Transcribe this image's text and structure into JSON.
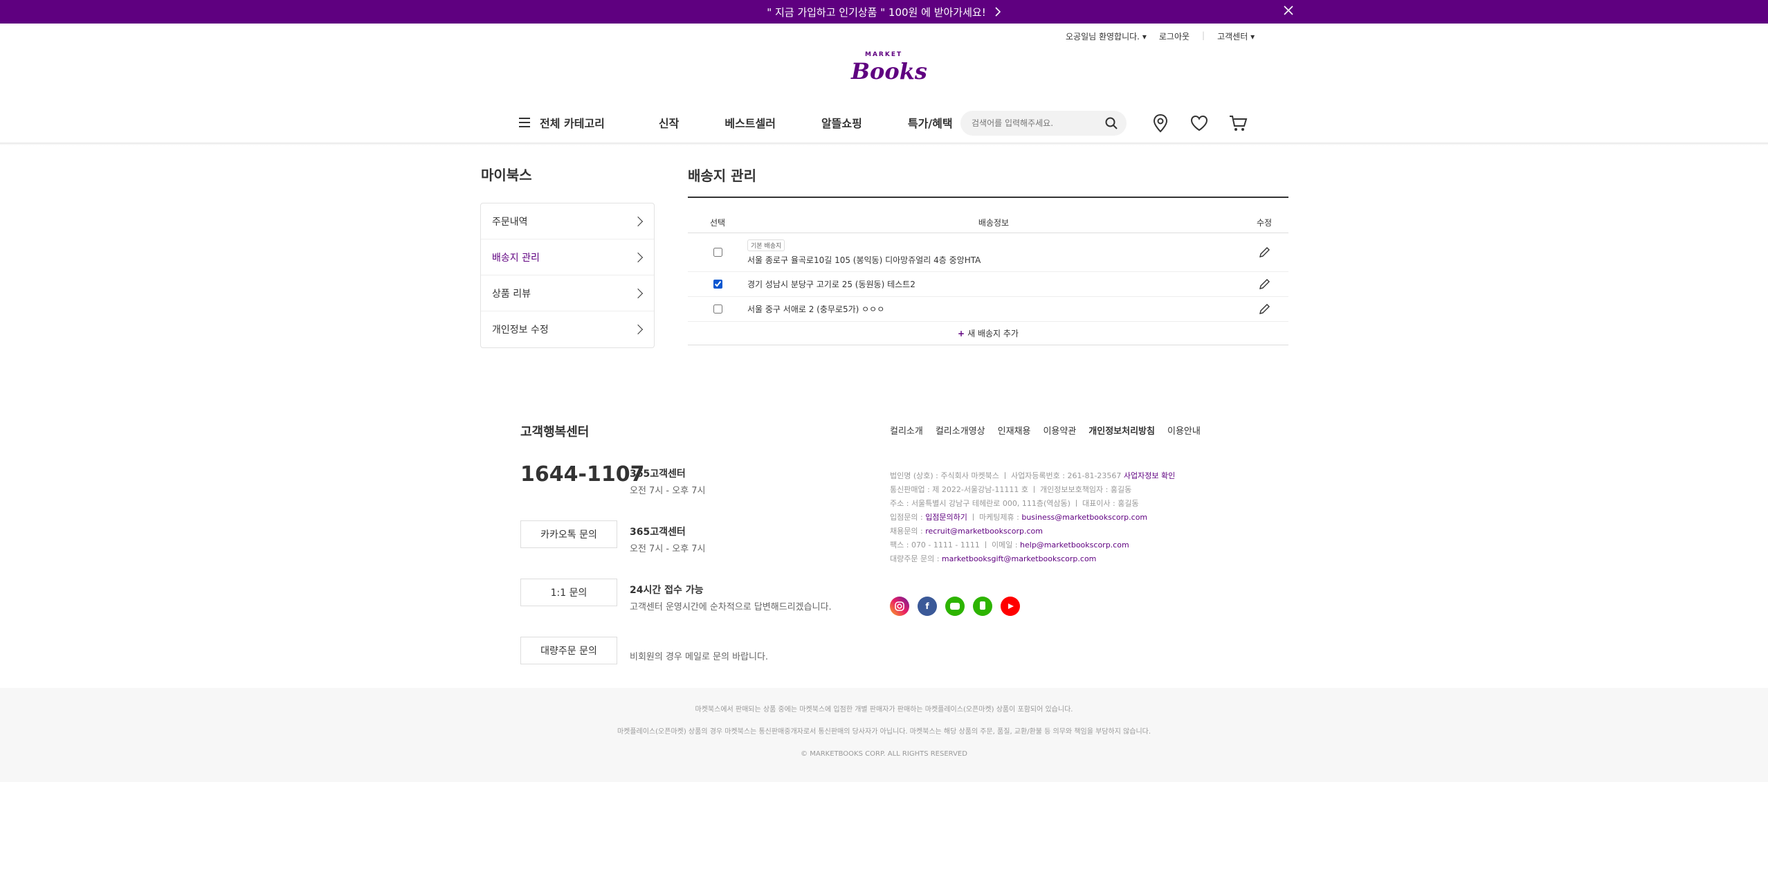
{
  "banner": {
    "message": "\" 지금 가입하고 인기상품 \" 100원 에 받아가세요!"
  },
  "user_menu": {
    "greeting": "오공일님 환영합니다.",
    "logout": "로그아웃",
    "customer_center": "고객센터"
  },
  "logo": {
    "small": "MARKET",
    "big": "Books"
  },
  "gnb": {
    "category": "전체 카테고리",
    "items": [
      "신작",
      "베스트셀러",
      "알뜰쇼핑",
      "특가/혜택"
    ],
    "search_placeholder": "검색어를 입력해주세요."
  },
  "sidebar": {
    "title": "마이북스",
    "items": [
      {
        "label": "주문내역"
      },
      {
        "label": "배송지 관리"
      },
      {
        "label": "상품 리뷰"
      },
      {
        "label": "개인정보 수정"
      }
    ]
  },
  "main": {
    "title": "배송지 관리",
    "headers": {
      "select": "선택",
      "info": "배송정보",
      "edit": "수정"
    },
    "rows": [
      {
        "badge": "기본 배송지",
        "address": "서울 종로구 율곡로10길 105 (봉익동) 디아망쥬얼리 4층 중앙HTA",
        "checked": false
      },
      {
        "address": "경기 성남시 분당구 고기로 25 (동원동) 테스트2",
        "checked": true
      },
      {
        "address": "서울 중구 서애로 2 (충무로5가) ㅇㅇㅇ",
        "checked": false
      }
    ],
    "add_label": "새 배송지 추가"
  },
  "footer": {
    "cs_title": "고객행복센터",
    "phone": "1644-1107",
    "blocks": [
      {
        "title": "365고객센터",
        "sub": "오전 7시 - 오후 7시"
      },
      {
        "title": "365고객센터",
        "sub": "오전 7시 - 오후 7시",
        "button": "카카오톡 문의"
      },
      {
        "title": "24시간 접수 가능",
        "sub": "고객센터 운영시간에 순차적으로 답변해드리겠습니다.",
        "button": "1:1 문의"
      },
      {
        "sub": "비회원의 경우 메일로 문의 바랍니다.",
        "button": "대량주문 문의"
      }
    ],
    "links": [
      "컬리소개",
      "컬리소개영상",
      "인재채용",
      "이용약관",
      "개인정보처리방침",
      "이용안내"
    ],
    "biz": {
      "line1": "법인명 (상호) : 주식회사 마켓북스  ㅣ  사업자등록번호 : 261-81-23567",
      "line1_link": "사업자정보 확인",
      "line2": "통신판매업 : 제 2022-서울강남-11111 호  ㅣ  개인정보보호책임자 : 홍길동",
      "line3": "주소 : 서울특별시 강남구 테헤란로 000, 111층(역삼동)  ㅣ  대표이사 : 홍길동",
      "line4_a": "입점문의 : ",
      "line4_link1": "입점문의하기",
      "line4_b": "  ㅣ  마케팅제휴 : ",
      "line4_link2": "business@marketbookscorp.com",
      "line5_a": "채용문의 : ",
      "line5_link": "recruit@marketbookscorp.com",
      "line6_a": "팩스 : 070 - 1111 - 1111  ㅣ  이메일 : ",
      "line6_link": "help@marketbookscorp.com",
      "line7_a": "대량주문 문의 : ",
      "line7_link": "marketbooksgift@marketbookscorp.com"
    },
    "sns": [
      "instagram-icon",
      "facebook-icon",
      "naver-blog-icon",
      "naver-post-icon",
      "youtube-icon"
    ],
    "bottom": [
      "마켓북스에서 판매되는 상품 중에는 마켓북스에 입점한 개별 판매자가 판매하는 마켓플레이스(오픈마켓) 상품이 포함되어 있습니다.",
      "마켓플레이스(오픈마켓) 상품의 경우 마켓북스는 통신판매중개자로서 통신판매의 당사자가 아닙니다. 마켓북스는 해당 상품의 주문, 품질, 교환/환불 등 의무와 책임을 부담하지 않습니다.",
      "© MARKETBOOKS CORP. ALL RIGHTS RESERVED"
    ]
  },
  "colors": {
    "brand": "#5f0080",
    "topbar_bg": "#5f0080"
  }
}
